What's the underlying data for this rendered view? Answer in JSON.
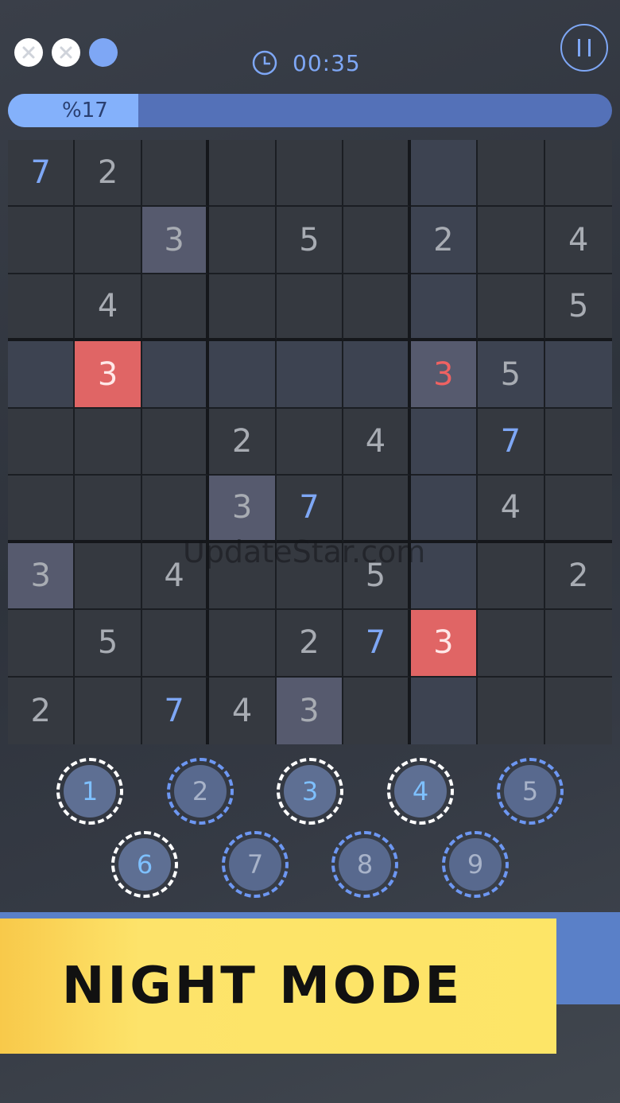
{
  "mistakes": [
    {
      "state": "used"
    },
    {
      "state": "used"
    },
    {
      "state": "available"
    }
  ],
  "timer": "00:35",
  "progress": {
    "label": "%17",
    "value": 0.17
  },
  "board": [
    [
      {
        "v": "7",
        "t": "user"
      },
      {
        "v": "2",
        "t": "given"
      },
      {
        "v": "",
        "t": "empty"
      },
      {
        "v": "",
        "t": "empty"
      },
      {
        "v": "",
        "t": "empty"
      },
      {
        "v": "",
        "t": "empty"
      },
      {
        "v": "",
        "t": "empty"
      },
      {
        "v": "",
        "t": "empty"
      },
      {
        "v": "",
        "t": "empty"
      }
    ],
    [
      {
        "v": "",
        "t": "empty"
      },
      {
        "v": "",
        "t": "empty"
      },
      {
        "v": "3",
        "t": "same"
      },
      {
        "v": "",
        "t": "empty"
      },
      {
        "v": "5",
        "t": "given"
      },
      {
        "v": "",
        "t": "empty"
      },
      {
        "v": "2",
        "t": "given"
      },
      {
        "v": "",
        "t": "empty"
      },
      {
        "v": "4",
        "t": "given"
      }
    ],
    [
      {
        "v": "",
        "t": "empty"
      },
      {
        "v": "4",
        "t": "given"
      },
      {
        "v": "",
        "t": "empty"
      },
      {
        "v": "",
        "t": "empty"
      },
      {
        "v": "",
        "t": "empty"
      },
      {
        "v": "",
        "t": "empty"
      },
      {
        "v": "",
        "t": "empty"
      },
      {
        "v": "",
        "t": "empty"
      },
      {
        "v": "5",
        "t": "given"
      }
    ],
    [
      {
        "v": "",
        "t": "empty"
      },
      {
        "v": "3",
        "t": "error"
      },
      {
        "v": "",
        "t": "empty"
      },
      {
        "v": "",
        "t": "empty"
      },
      {
        "v": "",
        "t": "empty"
      },
      {
        "v": "",
        "t": "empty"
      },
      {
        "v": "3",
        "t": "errortext"
      },
      {
        "v": "5",
        "t": "given"
      },
      {
        "v": "",
        "t": "empty"
      }
    ],
    [
      {
        "v": "",
        "t": "empty"
      },
      {
        "v": "",
        "t": "empty"
      },
      {
        "v": "",
        "t": "empty"
      },
      {
        "v": "2",
        "t": "given"
      },
      {
        "v": "",
        "t": "empty"
      },
      {
        "v": "4",
        "t": "given"
      },
      {
        "v": "",
        "t": "empty"
      },
      {
        "v": "7",
        "t": "user"
      },
      {
        "v": "",
        "t": "empty"
      }
    ],
    [
      {
        "v": "",
        "t": "empty"
      },
      {
        "v": "",
        "t": "empty"
      },
      {
        "v": "",
        "t": "empty"
      },
      {
        "v": "3",
        "t": "same"
      },
      {
        "v": "7",
        "t": "user"
      },
      {
        "v": "",
        "t": "empty"
      },
      {
        "v": "",
        "t": "empty"
      },
      {
        "v": "4",
        "t": "given"
      },
      {
        "v": "",
        "t": "empty"
      }
    ],
    [
      {
        "v": "3",
        "t": "same"
      },
      {
        "v": "",
        "t": "empty"
      },
      {
        "v": "4",
        "t": "given"
      },
      {
        "v": "",
        "t": "empty"
      },
      {
        "v": "",
        "t": "empty"
      },
      {
        "v": "5",
        "t": "given"
      },
      {
        "v": "",
        "t": "empty"
      },
      {
        "v": "",
        "t": "empty"
      },
      {
        "v": "2",
        "t": "given"
      }
    ],
    [
      {
        "v": "",
        "t": "empty"
      },
      {
        "v": "5",
        "t": "given"
      },
      {
        "v": "",
        "t": "empty"
      },
      {
        "v": "",
        "t": "empty"
      },
      {
        "v": "2",
        "t": "given"
      },
      {
        "v": "7",
        "t": "user"
      },
      {
        "v": "3",
        "t": "error"
      },
      {
        "v": "",
        "t": "empty"
      },
      {
        "v": "",
        "t": "empty"
      }
    ],
    [
      {
        "v": "2",
        "t": "given"
      },
      {
        "v": "",
        "t": "empty"
      },
      {
        "v": "7",
        "t": "user"
      },
      {
        "v": "4",
        "t": "given"
      },
      {
        "v": "3",
        "t": "same"
      },
      {
        "v": "",
        "t": "empty"
      },
      {
        "v": "",
        "t": "empty"
      },
      {
        "v": "",
        "t": "empty"
      },
      {
        "v": "",
        "t": "empty"
      }
    ]
  ],
  "number_pad": [
    {
      "label": "1",
      "style": "white"
    },
    {
      "label": "2",
      "style": "blue"
    },
    {
      "label": "3",
      "style": "white"
    },
    {
      "label": "4",
      "style": "white"
    },
    {
      "label": "5",
      "style": "blue"
    },
    {
      "label": "6",
      "style": "white"
    },
    {
      "label": "7",
      "style": "blue"
    },
    {
      "label": "8",
      "style": "blue"
    },
    {
      "label": "9",
      "style": "blue"
    }
  ],
  "banner": {
    "text": "NIGHT MODE"
  },
  "watermark": "UpdateStar.com",
  "colors": {
    "accent": "#7ea7f5",
    "error": "#e06565",
    "banner": "#fde567"
  },
  "icons": {
    "timer": "clock-icon",
    "pause": "pause-icon",
    "mistake": "close-icon"
  }
}
